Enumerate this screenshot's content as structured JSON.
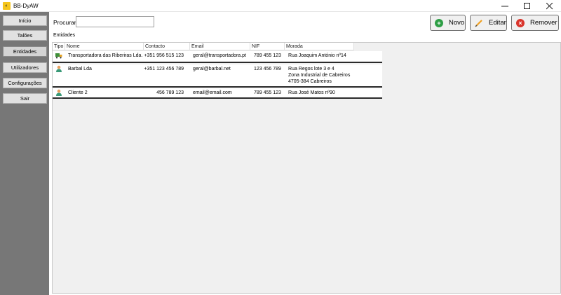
{
  "window": {
    "title": "BB-DyAW",
    "app_icon": "app-logo-icon"
  },
  "sidebar": {
    "items": [
      {
        "label": "Início"
      },
      {
        "label": "Talões"
      },
      {
        "label": "Entidades",
        "active": true
      },
      {
        "label": "Utilizadores"
      },
      {
        "label": "Configurações"
      },
      {
        "label": "Sair"
      }
    ]
  },
  "search": {
    "label": "Procurar",
    "value": "",
    "placeholder": ""
  },
  "section_title": "Entidades",
  "toolbar": {
    "new_label": "Novo",
    "edit_label": "Editar",
    "remove_label": "Remover",
    "colors": {
      "new": "#2e9e45",
      "edit": "#f0a020",
      "remove": "#d9342b"
    }
  },
  "table": {
    "columns": [
      "Tipo",
      "Nome",
      "Contacto",
      "Email",
      "NIF",
      "Morada"
    ],
    "rows": [
      {
        "type_icon": "truck-icon",
        "nome": "Transportadora das Riberiras Lda.",
        "contacto": "+351 956 515 123",
        "email": "geral@transportadora.pt",
        "nif": "789 455 123",
        "morada": [
          "Rua Joaquim António nº14"
        ]
      },
      {
        "type_icon": "person-icon",
        "nome": "Barbal Lda",
        "contacto": "+351 123 456 789",
        "email": "geral@barbal.net",
        "nif": "123 456 789",
        "morada": [
          "Rua Regos lote 3 e 4",
          "Zona Industrial de Cabreiros",
          "4705-384 Cabreiros"
        ]
      },
      {
        "type_icon": "person-icon",
        "nome": "Cliente 2",
        "contacto": "456 789 123",
        "email": "email@email.com",
        "nif": "789 455 123",
        "morada": [
          "Rua José Matos nº90"
        ]
      }
    ]
  }
}
